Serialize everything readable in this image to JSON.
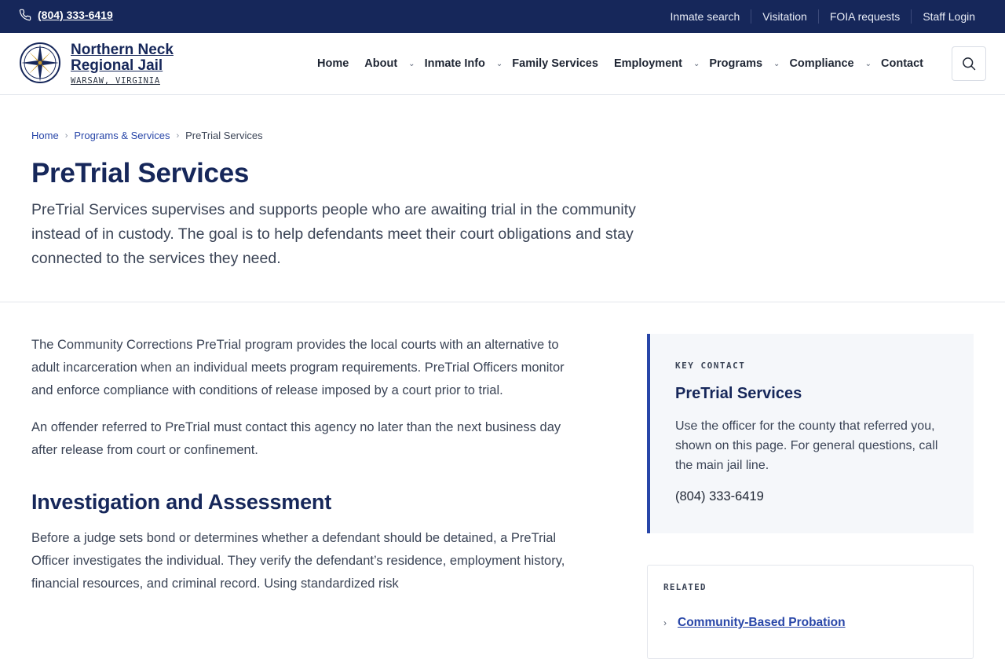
{
  "topbar": {
    "phone": "(804) 333-6419",
    "links": [
      "Inmate search",
      "Visitation",
      "FOIA requests",
      "Staff Login"
    ]
  },
  "brand": {
    "name_line1": "Northern Neck",
    "name_line2": "Regional Jail",
    "location": "WARSAW, VIRGINIA"
  },
  "nav": {
    "items": [
      {
        "label": "Home",
        "has_menu": false
      },
      {
        "label": "About",
        "has_menu": true
      },
      {
        "label": "Inmate Info",
        "has_menu": true
      },
      {
        "label": "Family Services",
        "has_menu": false
      },
      {
        "label": "Employment",
        "has_menu": true
      },
      {
        "label": "Programs",
        "has_menu": true
      },
      {
        "label": "Compliance",
        "has_menu": true
      },
      {
        "label": "Contact",
        "has_menu": false
      }
    ]
  },
  "breadcrumb": {
    "items": [
      "Home",
      "Programs & Services"
    ],
    "current": "PreTrial Services"
  },
  "page": {
    "title": "PreTrial Services",
    "lead": "PreTrial Services supervises and supports people who are awaiting trial in the community instead of in custody. The goal is to help defendants meet their court obligations and stay connected to the services they need."
  },
  "content": {
    "paragraphs": [
      "The Community Corrections PreTrial program provides the local courts with an alternative to adult incarceration when an individual meets program requirements. PreTrial Officers monitor and enforce compliance with conditions of release imposed by a court prior to trial.",
      "An offender referred to PreTrial must contact this agency no later than the next business day after release from court or confinement."
    ],
    "section_heading": "Investigation and Assessment",
    "section_paragraph": "Before a judge sets bond or determines whether a defendant should be detained, a PreTrial Officer investigates the individual. They verify the defendant’s residence, employment history, financial resources, and criminal record. Using standardized risk"
  },
  "key_contact": {
    "eyebrow": "KEY CONTACT",
    "title": "PreTrial Services",
    "body": "Use the officer for the county that referred you, shown on this page. For general questions, call the main jail line.",
    "phone": "(804) 333-6419"
  },
  "related": {
    "eyebrow": "RELATED",
    "items": [
      "Community-Based Probation"
    ]
  },
  "colors": {
    "navy": "#16275a",
    "link_blue": "#2846a8",
    "text": "#3b4456",
    "panel_bg": "#f5f7fa"
  }
}
